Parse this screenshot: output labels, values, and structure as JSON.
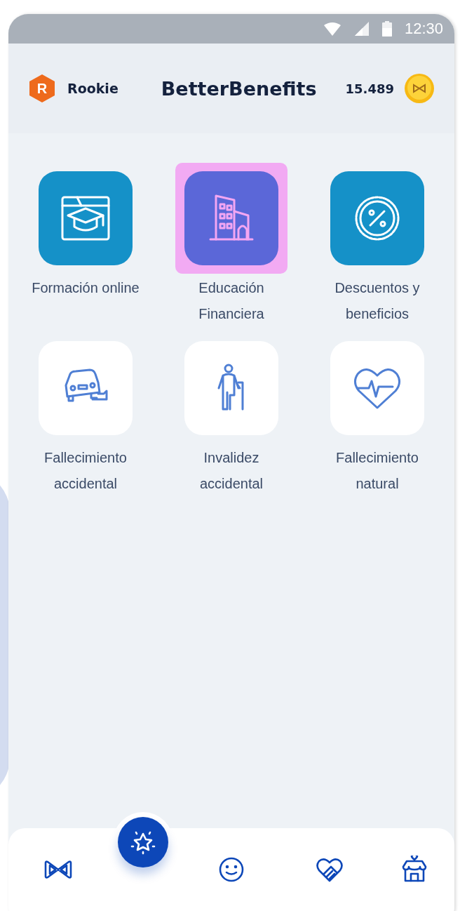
{
  "status_bar": {
    "time": "12:30"
  },
  "header": {
    "level_badge": "R",
    "level_name": "Rookie",
    "title": "BetterBenefits",
    "points": "15.489"
  },
  "tiles": [
    {
      "kind": "featured",
      "label": "Formación online",
      "selected": false
    },
    {
      "kind": "featured",
      "label": "Educación Financiera",
      "selected": true
    },
    {
      "kind": "featured",
      "label": "Descuentos y beneficios",
      "selected": false
    },
    {
      "kind": "plain",
      "label": "Fallecimiento accidental",
      "selected": false
    },
    {
      "kind": "plain",
      "label": "Invalidez accidental",
      "selected": false
    },
    {
      "kind": "plain",
      "label": "Fallecimiento natural",
      "selected": false
    }
  ],
  "bottom_nav": [
    {
      "selected": false
    },
    {
      "selected": true
    },
    {
      "selected": false
    },
    {
      "selected": false
    },
    {
      "selected": false
    }
  ]
}
